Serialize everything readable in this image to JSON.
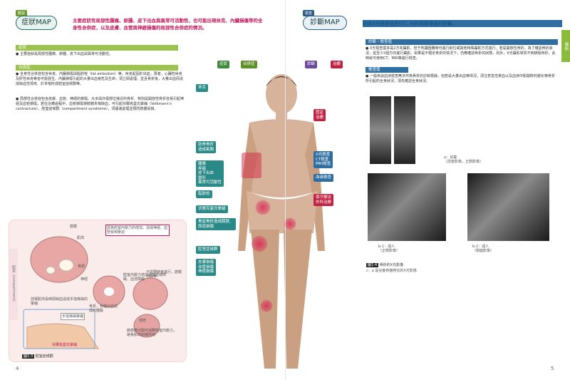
{
  "left_page": {
    "section_tag": "概説",
    "map_title": "症狀MAP",
    "header_desc": "主要症狀有局部性腫痛、瘀腫、皮下出血與異常可活動性，也可能出現休克、內臟損傷等的全身性合併症，以及皮膚、血管與神經損傷的局部性合併症的情況。",
    "sec1_title": "症狀",
    "sec1_text": "● 主要症狀是局部性腫痛、瘀腫、皮下出血與異常可活動性。",
    "sec2_title": "合併症",
    "sec2_text1": "● 全身性合併症包含休克、內臟損傷與脂肪栓（fat embolism）等。休克起因於出血，再者，心臟性休克及肝性休克等皆可能發生。內臟損傷引起的大量出血會危及生命，須立即處理。並且骨折後，大量出血而造成缺血性壞死、於末梢形成腔室症候群等。",
    "sec2_text2": "● 局部性合併症包含皮膚、血管、神經的損傷。大多與外傷部位接近的骨折、特別是開放性骨折容易引起神經及血管損傷。若在治療過程中，血管損傷使肢體末梢缺血，可引起伏爾克曼氏攣縮（Volkmann’s contracture）、腔室症候群（compartment syndrome），須儘速處理並預防肢體受損。",
    "page_number": "4",
    "figure_caption_num": "圖1-3",
    "figure_caption": "腔室症候群",
    "figure_vertical_label": "腔室（compartment）",
    "figure_notes": {
      "fascia": "筋膜",
      "bone": "骨頭",
      "muscle": "肌肉",
      "compartment_pressure": "因為腔室內壓力的增加，造成神經、血管受到壓迫",
      "nerve": "神經",
      "note_bleed": "骨折、骨髓出血造成的腫脹",
      "note_release": "不需要時會進行，筋膜切開等",
      "note_pressure": "腔室內壓力增加造成循環障礙、血流障礙",
      "note_fascia_cut": "將筋膜切開可減輕腔室內壓力，避免肌肉組織壞死",
      "note_bottom": "前臂肌肉長時間缺血造成手指彎曲的攣縮",
      "note_hand": "手指彎曲攣縮",
      "note_volkmann": "伏爾克曼氏攣縮",
      "note_necrosis": "壞死"
    }
  },
  "body_map": {
    "legend_symptom": "症狀",
    "legend_complication": "合併症",
    "legend_diagnosis": "診斷",
    "legend_treatment": "治療",
    "label_shock": "休克",
    "label_fat_embolism": "肋骨骨折\n造成氣胸",
    "label_symptoms_list": "腫脹\n疼痛\n皮下出血\n變形\n異常可活動性",
    "label_fat": "脂肪栓",
    "label_volkmann": "伏爾克曼氏攣縮",
    "label_bone": "骨盆骨折造成膀胱、\n尿道損傷",
    "label_compartment": "腔室症候群",
    "label_damage_list": "皮膚損傷\n血管損傷\n神經損傷",
    "label_fixation": "固定\n治療",
    "label_xray": "X光檢查\nCT檢查\nMRI檢查",
    "label_blood": "血液檢查",
    "label_rest": "保守療法\n外科治療"
  },
  "right_page": {
    "section_tag": "檢查",
    "map_title": "診斷MAP",
    "header_desc": "利用X光檢查或是CT、MRI的影像進行診斷。",
    "side_tab": "骨折",
    "sec1_title": "診斷・檢查值",
    "sec1_text": "● X光檢查基本是2方向攝影，但于判讀困難時可進行斜位或其他特殊攝影方式進行。若是開放性骨折，為了確認骨折狀況，從至少2個方向進行攝影。如果是不穩定骨折的情況下，仍應確認骨折的狀態。另外，X光攝影常見不到損傷骨折，此時就可使用CT、MRI等進行檢查。",
    "sec2_title": "檢查值",
    "sec2_text": "● 一般來說血液檢查無法作為骨折的診斷根據，但若是大量出血等情況，須注意急性貧血以及血液中肌酸酐的變化等骨折所引起的全身狀況，須先確認全身狀況。",
    "xray_caption_a": "a：兒童\n（前後影像，正側影像）",
    "xray_caption_b1": "b-1：成人\n（正側影像）",
    "xray_caption_b2": "b-2：成人\n（側面影像）",
    "figure_caption_num": "圖1-4",
    "figure_caption": "骨折的X光影像",
    "figure_subcaption": "c：a 是兒童骨骼骨化的X光影像",
    "page_number": "5"
  }
}
